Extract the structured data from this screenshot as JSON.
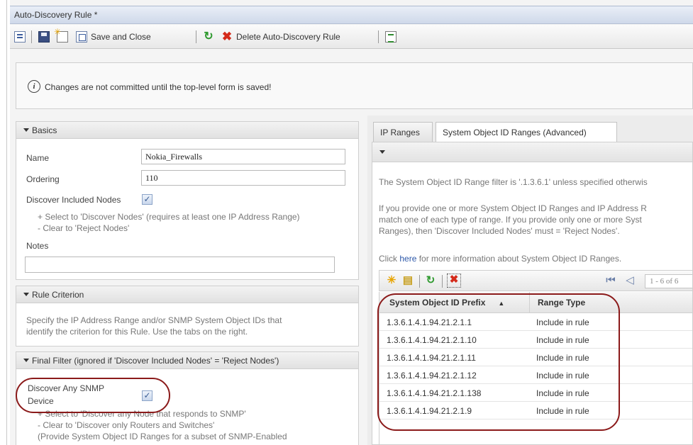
{
  "window": {
    "title": "Auto-Discovery Rule *"
  },
  "toolbar": {
    "save_close_label": "Save and Close",
    "delete_label": "Delete Auto-Discovery Rule"
  },
  "info": {
    "message": "Changes are not committed until the top-level form is saved!",
    "icon": "info-icon"
  },
  "basics": {
    "header": "Basics",
    "name_label": "Name",
    "name_value": "Nokia_Firewalls",
    "ordering_label": "Ordering",
    "ordering_value": "110",
    "discover_label": "Discover Included Nodes",
    "discover_checked": true,
    "hint1": "+ Select to 'Discover Nodes' (requires at least one IP Address Range)",
    "hint2": "- Clear to 'Reject Nodes'",
    "notes_label": "Notes",
    "notes_value": ""
  },
  "rule_criterion": {
    "header": "Rule Criterion",
    "text1": "Specify the IP Address Range and/or SNMP System Object IDs that",
    "text2": "identify the criterion for this Rule. Use the tabs on the right."
  },
  "final_filter": {
    "header": "Final Filter (ignored if 'Discover Included Nodes' = 'Reject Nodes')",
    "snmp_label_1": "Discover Any SNMP",
    "snmp_label_2": "Device",
    "snmp_checked": true,
    "hint1": "+ Select to 'Discover any Node that responds to SNMP'",
    "hint2": "- Clear to 'Discover only Routers and Switches'",
    "hint3": "(Provide System Object ID Ranges for a subset of SNMP-Enabled"
  },
  "tabs": [
    {
      "label": "IP Ranges",
      "active": false
    },
    {
      "label": "System Object ID Ranges (Advanced)",
      "active": true
    }
  ],
  "sysoid": {
    "line1": "The System Object ID Range filter is '.1.3.6.1' unless specified otherwis",
    "line2": "If you provide one or more System Object ID Ranges and IP Address R",
    "line3": "match one of each type of range. If you provide only one or more Syst",
    "line4": "Ranges), then 'Discover Included Nodes' must = 'Reject Nodes'.",
    "click_prefix": "Click ",
    "click_link": "here",
    "click_suffix": " for more information about System Object ID Ranges.",
    "pager_text": "1 - 6 of 6"
  },
  "grid": {
    "columns": [
      "System Object ID Prefix",
      "Range Type"
    ],
    "sort_indicator": "▲",
    "rows": [
      {
        "prefix": "1.3.6.1.4.1.94.21.2.1.1",
        "type": "Include in rule"
      },
      {
        "prefix": "1.3.6.1.4.1.94.21.2.1.10",
        "type": "Include in rule"
      },
      {
        "prefix": "1.3.6.1.4.1.94.21.2.1.11",
        "type": "Include in rule"
      },
      {
        "prefix": "1.3.6.1.4.1.94.21.2.1.12",
        "type": "Include in rule"
      },
      {
        "prefix": "1.3.6.1.4.1.94.21.2.1.138",
        "type": "Include in rule"
      },
      {
        "prefix": "1.3.6.1.4.1.94.21.2.1.9",
        "type": "Include in rule"
      }
    ]
  },
  "colors": {
    "highlight": "#8b1a1a",
    "link": "#2c57a8",
    "refresh": "#2f9a2f",
    "delete": "#d42a1a"
  }
}
